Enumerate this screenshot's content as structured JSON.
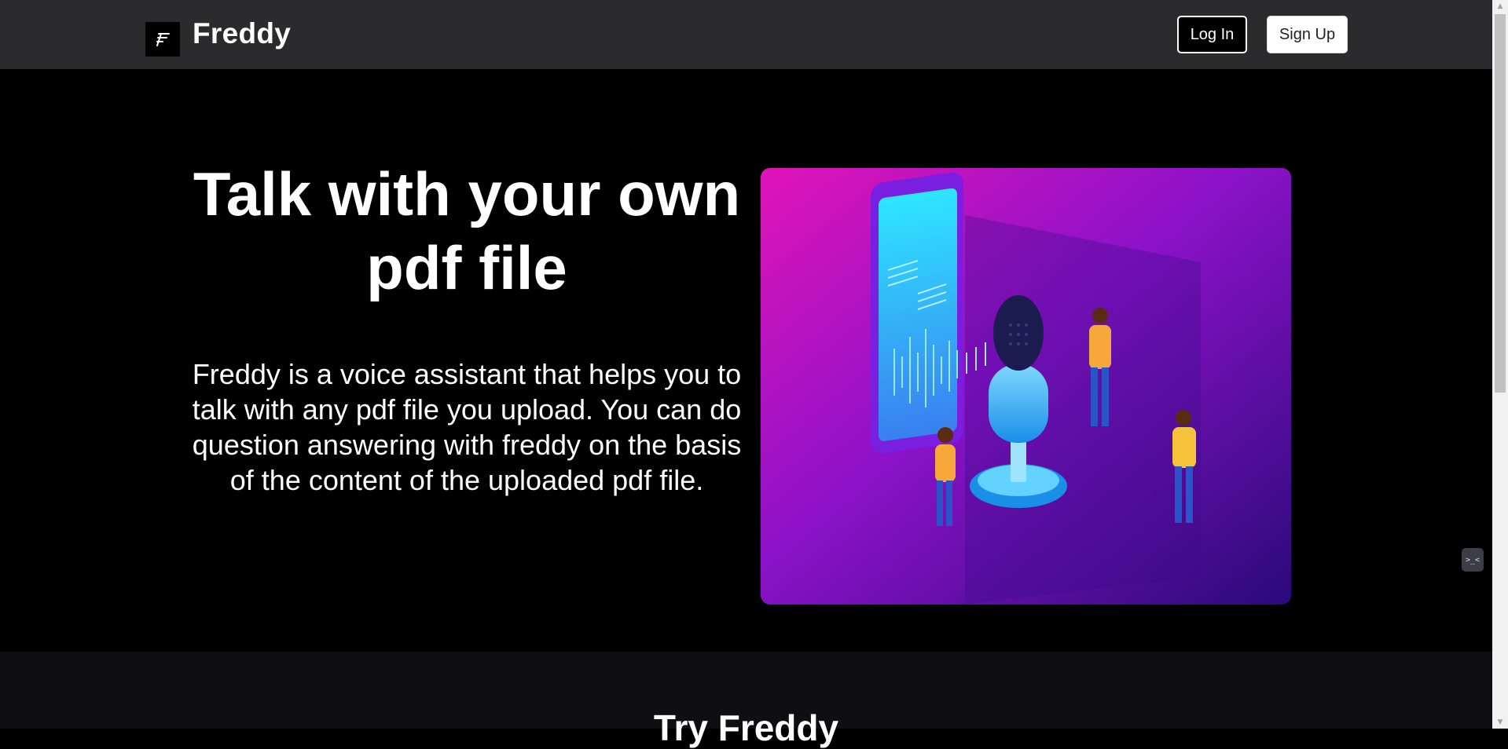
{
  "header": {
    "brand": "Freddy",
    "logo_icon": "freddy-f-logo",
    "login_label": "Log In",
    "signup_label": "Sign Up"
  },
  "hero": {
    "title": "Talk with your own pdf file",
    "description": "Freddy is a voice assistant that helps you to talk with any pdf file you upload. You can do question answering with freddy on the basis of the content of the uploaded pdf file.",
    "illustration_icon": "voice-assistant-illustration"
  },
  "section2": {
    "title": "Try Freddy"
  },
  "colors": {
    "navbar": "#2b2b2d",
    "hero_bg": "#000000",
    "section2_bg": "#0f0f13",
    "illus_gradient_start": "#e014b8",
    "illus_gradient_end": "#2a0a7a"
  }
}
